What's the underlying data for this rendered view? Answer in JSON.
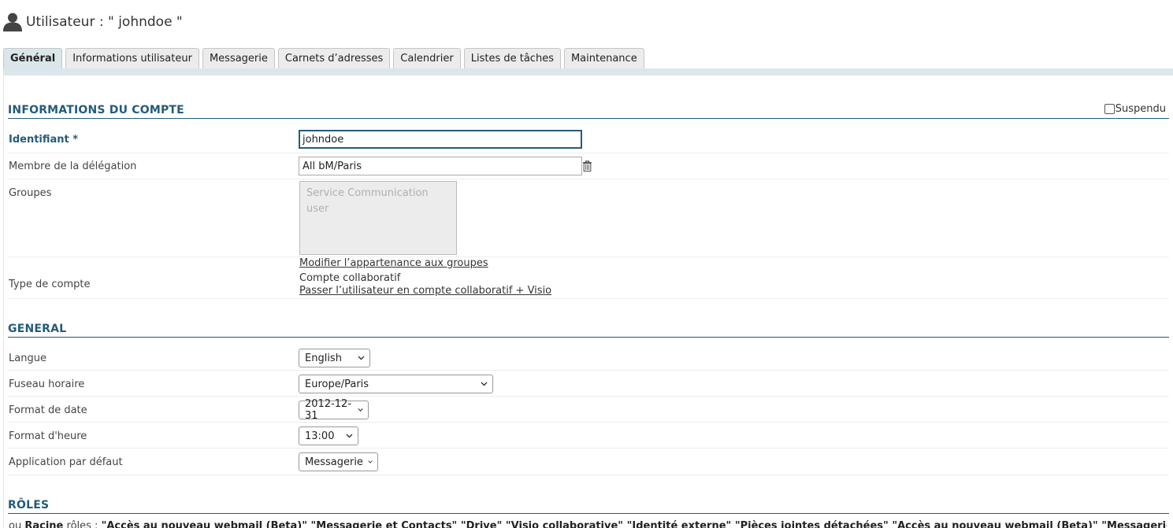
{
  "header": {
    "title": "Utilisateur : \" johndoe \"",
    "icon": "user-icon"
  },
  "tabs": [
    {
      "label": "Général",
      "active": true
    },
    {
      "label": "Informations utilisateur"
    },
    {
      "label": "Messagerie"
    },
    {
      "label": "Carnets d’adresses"
    },
    {
      "label": "Calendrier"
    },
    {
      "label": "Listes de tâches"
    },
    {
      "label": "Maintenance"
    }
  ],
  "account": {
    "section_title": "INFORMATIONS DU COMPTE",
    "suspend_label": "Suspendu",
    "suspend_checked": false,
    "login_label": "Identifiant *",
    "login_value": "johndoe",
    "delegation_label": "Membre de la délégation",
    "delegation_value": "All bM/Paris",
    "groups_label": "Groupes",
    "groups": [
      "Service Communication",
      "user"
    ],
    "groups_link": "Modifier l’appartenance aux groupes",
    "account_type_label": "Type de compte",
    "account_type_value": "Compte collaboratif",
    "account_type_link": "Passer l’utilisateur en compte collaboratif + Visio"
  },
  "general": {
    "section_title": "GENERAL",
    "language_label": "Langue",
    "language_value": "English",
    "timezone_label": "Fuseau horaire",
    "timezone_value": "Europe/Paris",
    "date_format_label": "Format de date",
    "date_format_value": "2012-12-31",
    "time_format_label": "Format d'heure",
    "time_format_value": "13:00",
    "default_app_label": "Application par défaut",
    "default_app_value": "Messagerie"
  },
  "roles": {
    "section_title": "RÔLES",
    "line_prefix": "ou",
    "line_name": "Racine",
    "line_mid": "rôles :",
    "line_roles": "\"Accès au nouveau webmail (Beta)\" \"Messagerie et Contacts\" \"Drive\" \"Visio collaborative\" \"Identité externe\" \"Pièces jointes détachées\" \"Accès au nouveau webmail (Beta)\" \"Messagerie et Contacts\" \"Agenda et"
  },
  "colors": {
    "accent": "#245b79",
    "tab_active": "#dbe6ea",
    "tab_bg": "#ececec"
  }
}
